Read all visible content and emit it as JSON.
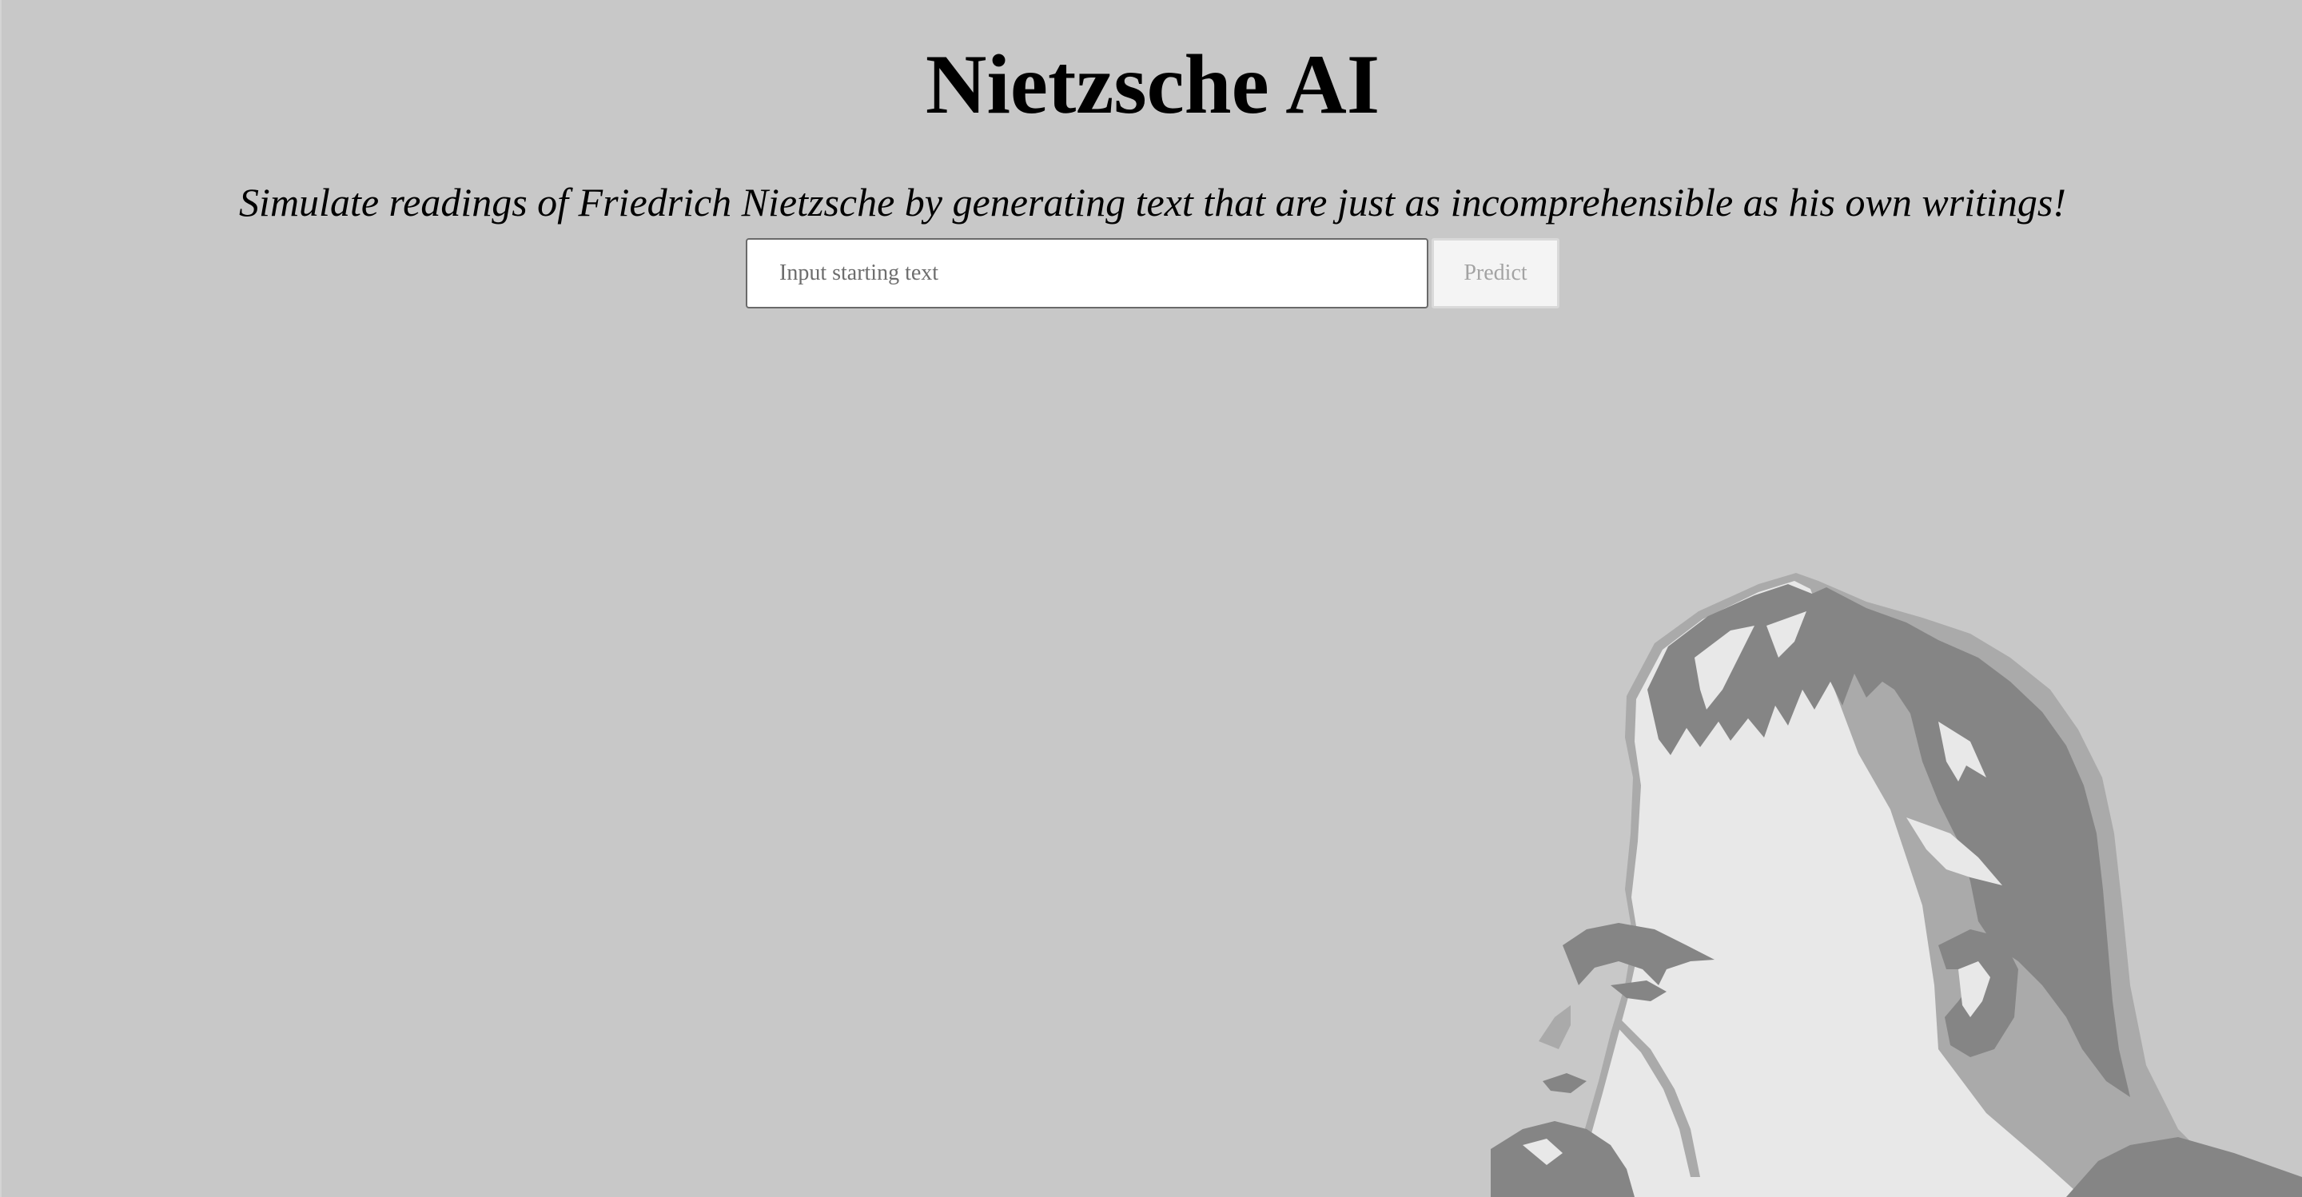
{
  "header": {
    "title": "Nietzsche AI",
    "subtitle": "Simulate readings of Friedrich Nietzsche by generating text that are just as incomprehensible as his own writings!"
  },
  "form": {
    "input_placeholder": "Input starting text",
    "input_value": "",
    "predict_label": "Predict",
    "predict_disabled": true
  },
  "colors": {
    "background": "#c8c8c8",
    "portrait_dark": "#858585",
    "portrait_light": "#e8e8e8",
    "portrait_outline": "#aaaaaa"
  }
}
